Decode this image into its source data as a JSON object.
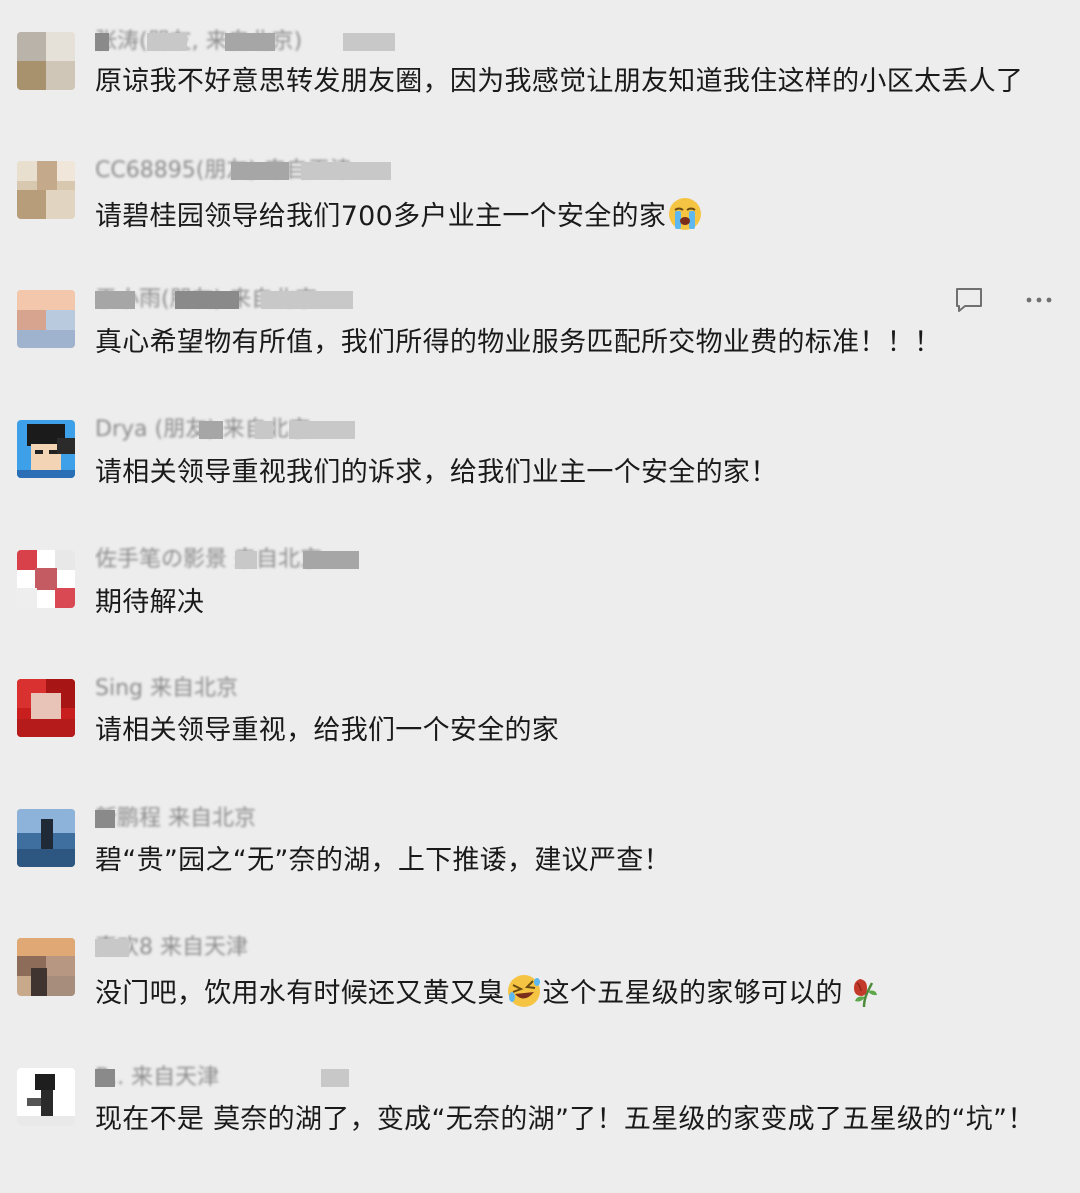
{
  "comments": [
    {
      "username": "张涛(朋友, 来自北京)",
      "text": "原谅我不好意思转发朋友圈，因为我感觉让朋友知道我住这样的小区太丢人了"
    },
    {
      "username": "CC68895(朋友) 来自天津",
      "text_before_emoji": "请碧桂园领导给我们700多户业主一个安全的家",
      "emoji": "crying-face"
    },
    {
      "username": "于小雨(朋友) 来自北京",
      "text": "真心希望物有所值，我们所得的物业服务匹配所交物业费的标准！！！",
      "reply_icon": "comment-icon",
      "more_icon": "more-icon"
    },
    {
      "username": "Drya (朋友) 来自北京",
      "text": "请相关领导重视我们的诉求，给我们业主一个安全的家！"
    },
    {
      "username": "佐手笔の影景 来自北京",
      "text": "期待解决"
    },
    {
      "username": "Sing 来自北京",
      "text": "请相关领导重视，给我们一个安全的家"
    },
    {
      "username": "新鹏程 来自北京",
      "text": "碧“贵”园之“无”奈的湖，上下推诿，建议严查！"
    },
    {
      "username": "真欢8 来自天津",
      "text_before_emoji": "没门吧，饮用水有时候还又黄又臭",
      "emoji": "rolling-laughing-face",
      "text_after_emoji": "这个五星级的家够可以的",
      "emoji_2": "wilted-rose"
    },
    {
      "username": "B.. 来自天津",
      "text": "现在不是 莫奈的湖了，变成“无奈的湖”了！五星级的家变成了五星级的“坑”！"
    }
  ]
}
